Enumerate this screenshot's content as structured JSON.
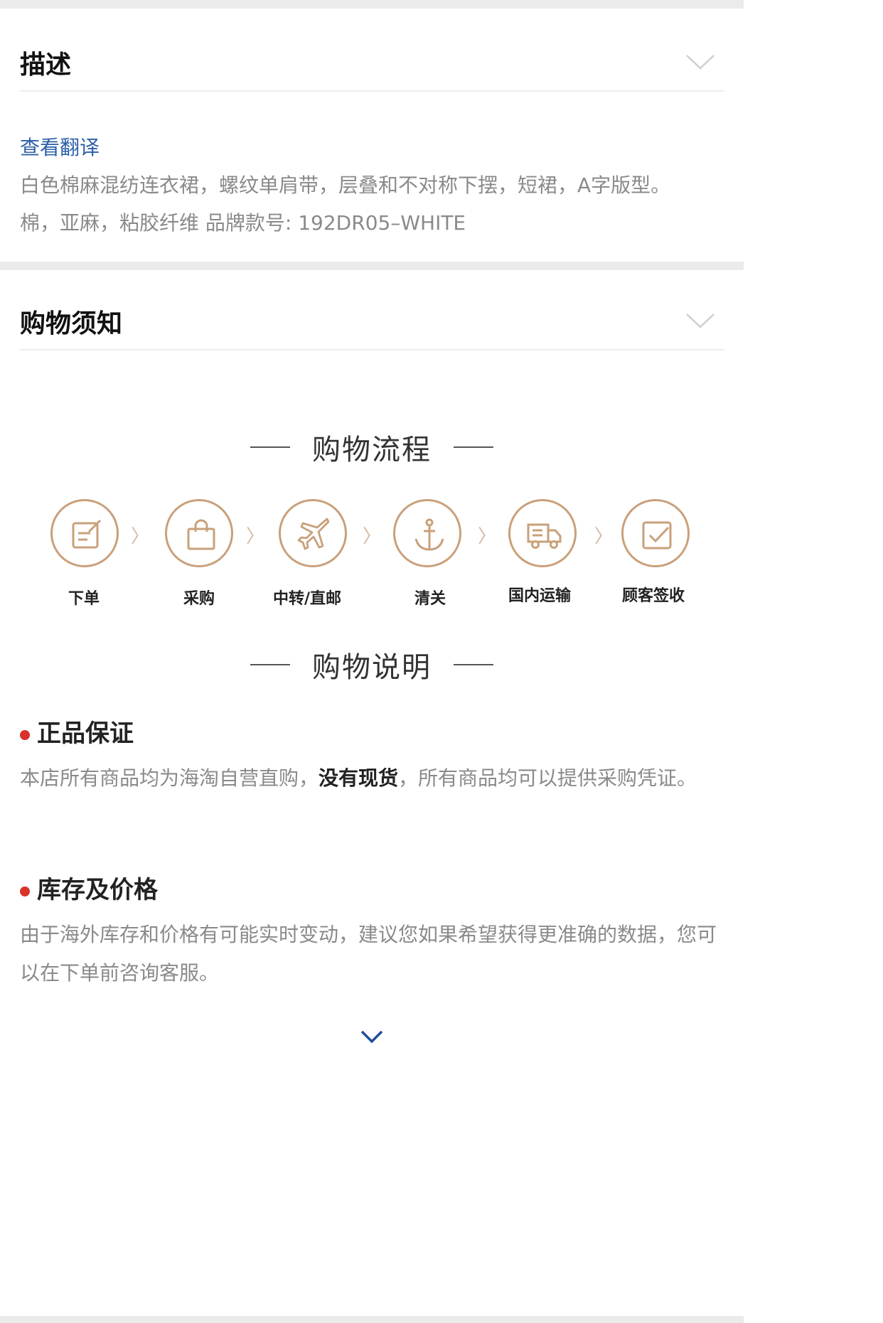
{
  "description": {
    "title": "描述",
    "translate_link": "查看翻译",
    "text_line1": "白色棉麻混纺连衣裙，螺纹单肩带，层叠和不对称下摆，短裙，A字版型。",
    "text_line2": "棉，亚麻，粘胶纤维 品牌款号: 192DR05–WHITE"
  },
  "shopping_notice": {
    "title": "购物须知",
    "process_heading": "购物流程",
    "steps": [
      {
        "label": "下单",
        "icon": "edit-icon"
      },
      {
        "label": "采购",
        "icon": "shopping-bag-icon"
      },
      {
        "label": "中转/直邮",
        "icon": "airplane-icon"
      },
      {
        "label": "清关",
        "icon": "anchor-icon"
      },
      {
        "label": "国内运输",
        "icon": "truck-icon"
      },
      {
        "label": "顾客签收",
        "icon": "check-box-icon"
      }
    ],
    "step_arrow": "〉",
    "instructions_heading": "购物说明",
    "items": [
      {
        "title": "正品保证",
        "text_before": "本店所有商品均为海淘自营直购，",
        "text_bold": "没有现货",
        "text_after": "，所有商品均可以提供采购凭证。"
      },
      {
        "title": "库存及价格",
        "text": "由于海外库存和价格有可能实时变动，建议您如果希望获得更准确的数据，您可以在下单前咨询客服。"
      }
    ]
  },
  "colors": {
    "accent_gold": "#c9a07a",
    "link_blue": "#2c5fa8",
    "bullet_red": "#d9322b",
    "expand_arrow": "#1f4e9c"
  }
}
